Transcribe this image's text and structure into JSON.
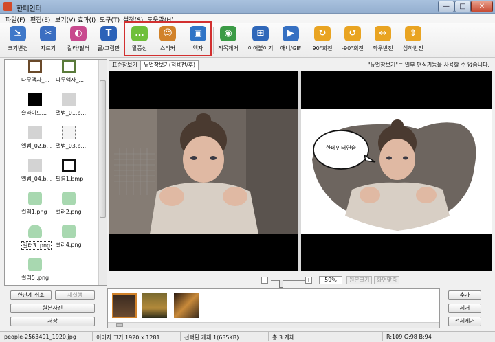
{
  "window": {
    "title": "한페인터",
    "close_glyph": "✕",
    "max_glyph": "□",
    "min_glyph": "—"
  },
  "menu": [
    "파일(F)",
    "편집(E)",
    "보기(V)",
    "효과(I)",
    "도구(T)",
    "설정(S)",
    "도움말(H)"
  ],
  "toolbar": [
    {
      "label": "크기변경",
      "icon": "resize-icon",
      "color": "#3f78c9",
      "glyph": "⇲"
    },
    {
      "label": "자르기",
      "icon": "crop-icon",
      "color": "#3b6ec1",
      "glyph": "✂"
    },
    {
      "label": "칼라/필터",
      "icon": "color-filter-icon",
      "color": "#c84a8e",
      "glyph": "◐"
    },
    {
      "label": "글/그림판",
      "icon": "text-draw-icon",
      "color": "#2c62b8",
      "glyph": "T"
    },
    {
      "label": "말풍선",
      "icon": "speech-bubble-icon",
      "color": "#6fbf3a",
      "glyph": "…"
    },
    {
      "label": "스티커",
      "icon": "sticker-icon",
      "color": "#d1822a",
      "glyph": "☺"
    },
    {
      "label": "액자",
      "icon": "frame-icon",
      "color": "#2f74c6",
      "glyph": "▣"
    },
    {
      "label": "적목제거",
      "icon": "red-eye-icon",
      "color": "#3b9b46",
      "glyph": "◉"
    },
    {
      "label": "이어붙이기",
      "icon": "merge-icon",
      "color": "#2f67b9",
      "glyph": "⊞"
    },
    {
      "label": "애니/GIF",
      "icon": "gif-icon",
      "color": "#3670c2",
      "glyph": "▶"
    },
    {
      "label": "90°회전",
      "icon": "rotate-right-icon",
      "color": "#e9a422",
      "glyph": "↻"
    },
    {
      "label": "-90°회전",
      "icon": "rotate-left-icon",
      "color": "#e9a422",
      "glyph": "↺"
    },
    {
      "label": "좌우반전",
      "icon": "flip-horizontal-icon",
      "color": "#e9a422",
      "glyph": "⇔"
    },
    {
      "label": "상하반전",
      "icon": "flip-vertical-icon",
      "color": "#e9a422",
      "glyph": "⇕"
    }
  ],
  "files": [
    {
      "label": "나무액자_...",
      "thumb": "frame-wood"
    },
    {
      "label": "나무액자_...",
      "thumb": "frame-green"
    },
    {
      "label": "슬라이드...",
      "thumb": "black"
    },
    {
      "label": "앨범_01.b...",
      "thumb": "gray"
    },
    {
      "label": "앨범_02.b...",
      "thumb": "gray"
    },
    {
      "label": "앨범_03.b...",
      "thumb": "dotted"
    },
    {
      "label": "앨범_04.b...",
      "thumb": "gray"
    },
    {
      "label": "필름1.bmp",
      "thumb": "film"
    },
    {
      "label": "컬러1.png",
      "thumb": "mint"
    },
    {
      "label": "컬러2.png",
      "thumb": "mint"
    },
    {
      "label": "컬러3 .png",
      "thumb": "mint-heart",
      "selected": true
    },
    {
      "label": "컬러4.png",
      "thumb": "mint"
    },
    {
      "label": "컬러5 .png",
      "thumb": "mint"
    }
  ],
  "viewer": {
    "tabs": [
      "표준장보기",
      "듀얼장보기(적용전/후)"
    ],
    "note": "\"듀얼장보기\"는 일부 편집기능을 사용할 수 없습니다.",
    "bubble_text": "한페인터연습"
  },
  "zoom": {
    "minus": "−",
    "plus": "+",
    "value": "59%",
    "original_size": "원본크기",
    "fit_screen": "화면맞춤"
  },
  "left_buttons": {
    "undo": "한단계 취소",
    "redo": "재실행",
    "original": "원본사진",
    "save": "저장"
  },
  "right_buttons": {
    "add": "추가",
    "remove": "제거",
    "remove_all": "전체제거"
  },
  "status": {
    "filename": "people-2563491_1920.jpg",
    "image_size": "이미지 크기:1920 x 1281",
    "selected": "선택된 개체:1(635KB)",
    "total": "총 3 개체",
    "rgb": "R:109 G:98 B:94"
  }
}
